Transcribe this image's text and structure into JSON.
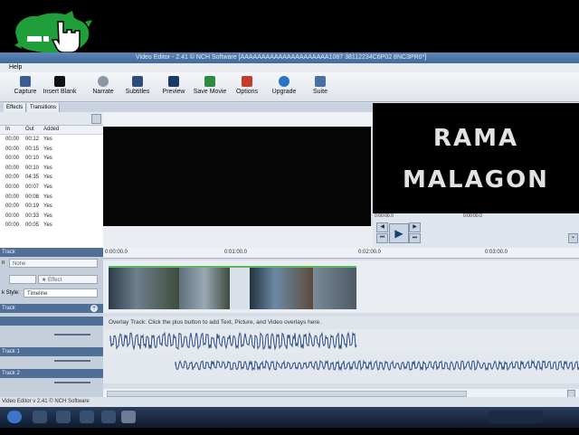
{
  "app": {
    "title": "Video Editor - 2.41 © NCH Software [AAAAAAAAAAAAAAAAAAAAA1087 38112234C6P02 8NC3PR0*]",
    "status_text": "Video Editor v 2.41 © NCH Software"
  },
  "menu": [
    "Help"
  ],
  "toolbar": [
    {
      "label": "Capture",
      "icon": "camera-icon"
    },
    {
      "label": "Insert Blank",
      "icon": "blank-clip-icon"
    },
    {
      "label": "Narrate",
      "icon": "microphone-icon"
    },
    {
      "label": "Subtitles",
      "icon": "subtitles-icon"
    },
    {
      "label": "Preview",
      "icon": "film-icon"
    },
    {
      "label": "Save Movie",
      "icon": "save-movie-icon"
    },
    {
      "label": "Options",
      "icon": "options-icon"
    },
    {
      "label": "Upgrade",
      "icon": "upgrade-icon"
    },
    {
      "label": "Suite",
      "icon": "suite-icon"
    }
  ],
  "tabs": [
    "Effects",
    "Transitions"
  ],
  "clip_list": {
    "columns": [
      "In",
      "Out",
      "Added"
    ],
    "rows": [
      {
        "in": "00:00",
        "out": "00:12",
        "added": "Yes"
      },
      {
        "in": "00:00",
        "out": "00:15",
        "added": "Yes"
      },
      {
        "in": "00:00",
        "out": "00:10",
        "added": "Yes"
      },
      {
        "in": "00:00",
        "out": "00:10",
        "added": "Yes"
      },
      {
        "in": "00:00",
        "out": "04:35",
        "added": "Yes"
      },
      {
        "in": "00:00",
        "out": "00:07",
        "added": "Yes"
      },
      {
        "in": "00:00",
        "out": "00:08",
        "added": "Yes"
      },
      {
        "in": "00:00",
        "out": "00:19",
        "added": "Yes"
      },
      {
        "in": "00:00",
        "out": "00:33",
        "added": "Yes"
      },
      {
        "in": "00:00",
        "out": "00:05",
        "added": "Yes"
      }
    ]
  },
  "preview_right": {
    "line1": "RAMA",
    "line2": "MALAGON",
    "time_left": "0:00:00.0",
    "time_right": "0:00:00.0"
  },
  "timeline": {
    "ticks": [
      "0:00:00.0",
      "0:01:00.0",
      "0:02:00.0",
      "0:03:00.0"
    ],
    "overlay_hint": "Overlay Track: Click the plus button to add Text, Picture, and Video overlays here."
  },
  "track_panel": {
    "video_track_label": "Track",
    "transition_label": "n",
    "transition_value": "None",
    "effect_label": "Effect",
    "style_label": "k Style:",
    "style_value": "Timeline",
    "overlay_track_label": "Track",
    "audio_track1_label": "Track 1",
    "audio_track2_label": "Track 2"
  },
  "colors": {
    "titlebar": "#4d77a8",
    "waveform": "#2e4f86",
    "clip_marker": "#4caf50"
  }
}
